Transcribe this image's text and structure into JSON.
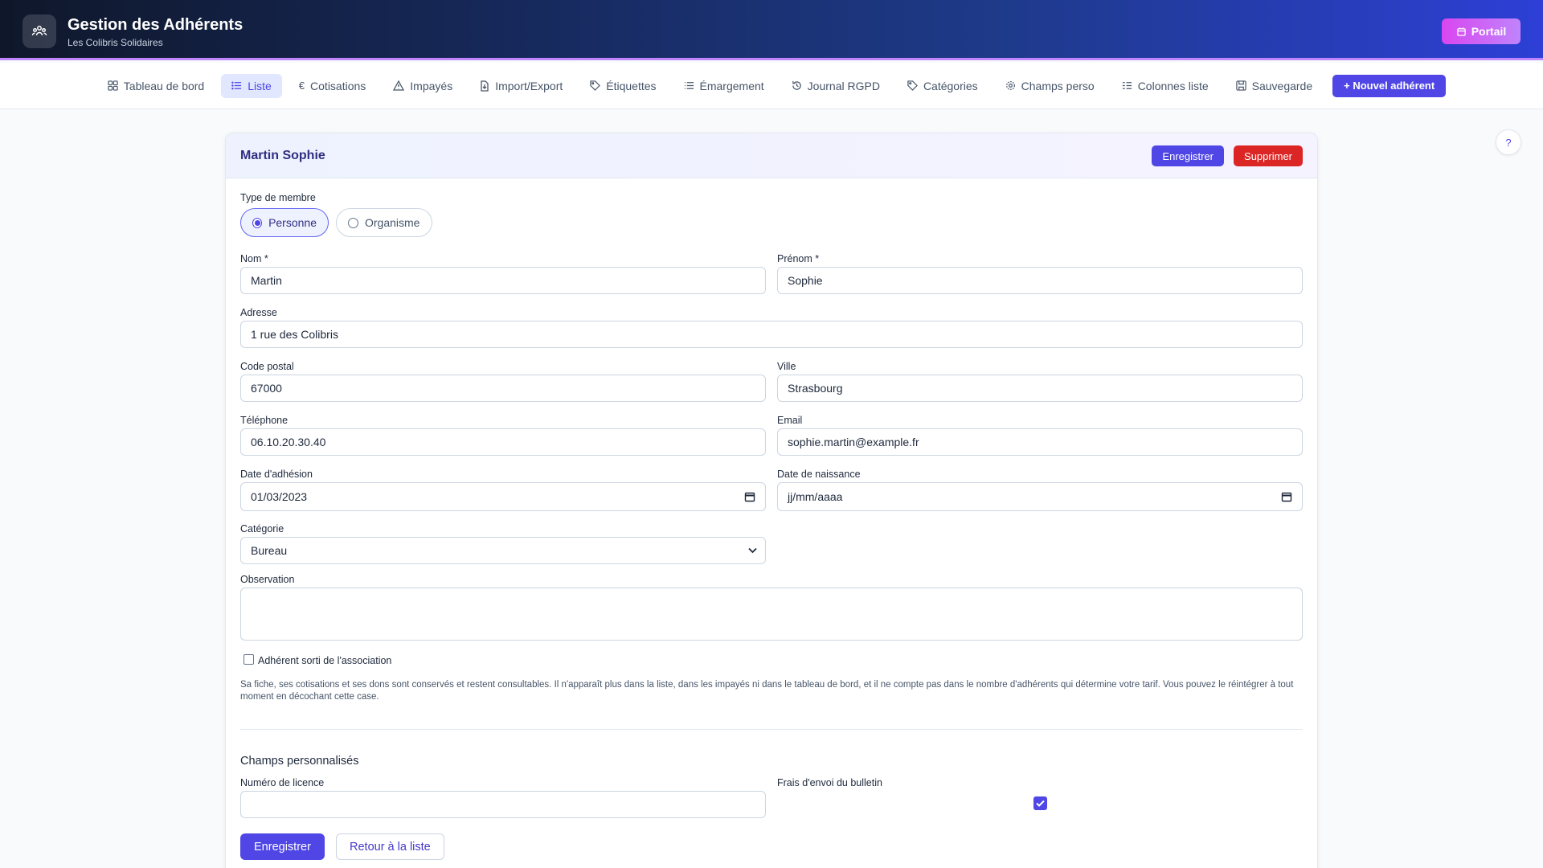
{
  "header": {
    "title": "Gestion des Adhérents",
    "subtitle": "Les Colibris Solidaires",
    "portal_label": "Portail",
    "logo_icon": "people-icon"
  },
  "nav": {
    "items": [
      {
        "label": "Tableau de bord",
        "icon": "dashboard-icon"
      },
      {
        "label": "Liste",
        "icon": "list-icon",
        "active": true
      },
      {
        "label": "Cotisations",
        "icon": "euro-icon"
      },
      {
        "label": "Impayés",
        "icon": "warning-icon"
      },
      {
        "label": "Import/Export",
        "icon": "file-transfer-icon"
      },
      {
        "label": "Étiquettes",
        "icon": "tag-icon"
      },
      {
        "label": "Émargement",
        "icon": "list-lines-icon"
      },
      {
        "label": "Journal RGPD",
        "icon": "history-icon"
      },
      {
        "label": "Catégories",
        "icon": "tag-icon"
      },
      {
        "label": "Champs perso",
        "icon": "gear-icon"
      },
      {
        "label": "Colonnes liste",
        "icon": "columns-icon"
      },
      {
        "label": "Sauvegarde",
        "icon": "save-icon"
      }
    ],
    "new_member_label": "+ Nouvel adhérent"
  },
  "help_label": "?",
  "card": {
    "title": "Martin Sophie",
    "save_label": "Enregistrer",
    "delete_label": "Supprimer"
  },
  "form": {
    "member_type": {
      "label": "Type de membre",
      "options": [
        "Personne",
        "Organisme"
      ],
      "selected": "Personne"
    },
    "nom": {
      "label": "Nom *",
      "value": "Martin"
    },
    "prenom": {
      "label": "Prénom *",
      "value": "Sophie"
    },
    "adresse": {
      "label": "Adresse",
      "value": "1 rue des Colibris"
    },
    "code_postal": {
      "label": "Code postal",
      "value": "67000"
    },
    "ville": {
      "label": "Ville",
      "value": "Strasbourg"
    },
    "telephone": {
      "label": "Téléphone",
      "value": "06.10.20.30.40"
    },
    "email": {
      "label": "Email",
      "value": "sophie.martin@example.fr"
    },
    "date_adhesion": {
      "label": "Date d'adhésion",
      "value": "01/03/2023"
    },
    "date_naissance": {
      "label": "Date de naissance",
      "placeholder": "jj/mm/aaaa"
    },
    "categorie": {
      "label": "Catégorie",
      "value": "Bureau"
    },
    "observation": {
      "label": "Observation",
      "value": ""
    },
    "sorti": {
      "label": "Adhérent sorti de l'association",
      "checked": false,
      "note": "Sa fiche, ses cotisations et ses dons sont conservés et restent consultables. Il n'apparaît plus dans la liste, dans les impayés ni dans le tableau de bord, et il ne compte pas dans le nombre d'adhérents qui détermine votre tarif. Vous pouvez le réintégrer à tout moment en décochant cette case."
    },
    "custom": {
      "title": "Champs personnalisés",
      "licence": {
        "label": "Numéro de licence",
        "value": ""
      },
      "frais_envoi": {
        "label": "Frais d'envoi du bulletin",
        "checked": true
      }
    },
    "save_label": "Enregistrer",
    "back_label": "Retour à la liste"
  },
  "colors": {
    "accent": "#4f46e5",
    "danger": "#dc2626",
    "header_dark": "#0f172a",
    "header_blue": "#2d3fd6",
    "portal": "#d946ef"
  }
}
